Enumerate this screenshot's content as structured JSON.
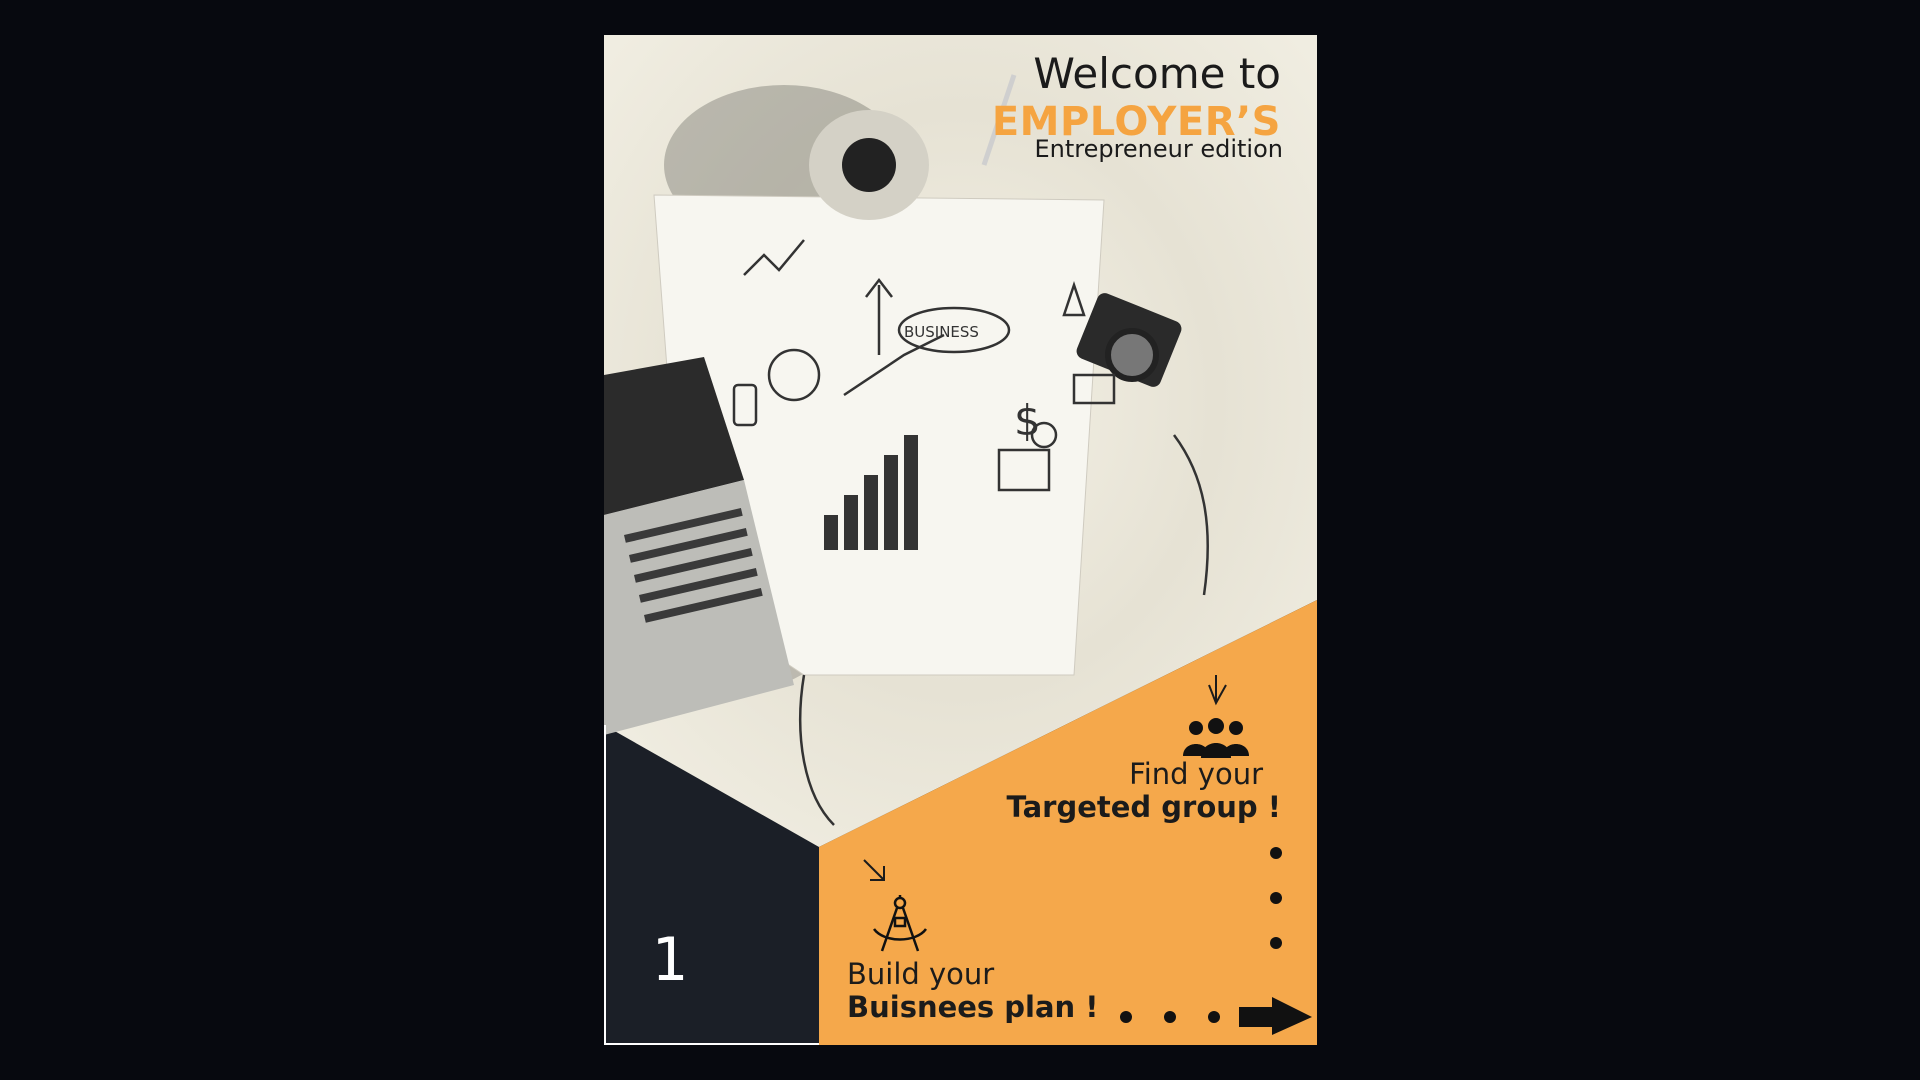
{
  "title": {
    "welcome": "Welcome to",
    "brand": "EMPLOYER’S",
    "edition": "Entrepreneur edition"
  },
  "steps": [
    {
      "line1": "Find your",
      "line2": "Targeted group !",
      "icon": "group-icon"
    },
    {
      "line1": "Build your",
      "line2": "Buisnees plan !",
      "icon": "compass-icon"
    }
  ],
  "page_number": "1",
  "colors": {
    "accent": "#f5a441",
    "dark": "#1b1f27",
    "background": "#07090f",
    "photo": "#efece0"
  }
}
